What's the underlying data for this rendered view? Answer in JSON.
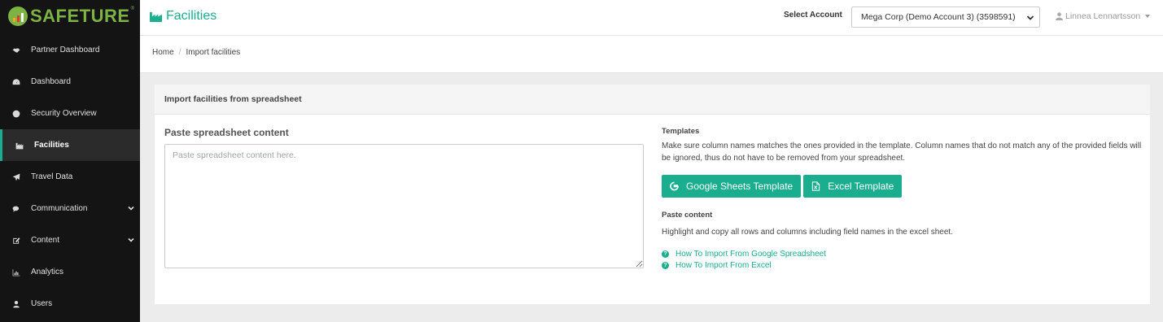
{
  "brand": {
    "name": "SAFETURE",
    "reg": "®",
    "accent": "#7cb342"
  },
  "sidebar": {
    "items": [
      {
        "label": "Partner Dashboard",
        "icon": "handshake-icon"
      },
      {
        "label": "Dashboard",
        "icon": "dashboard-icon"
      },
      {
        "label": "Security Overview",
        "icon": "globe-icon"
      },
      {
        "label": "Facilities",
        "icon": "factory-icon",
        "active": true
      },
      {
        "label": "Travel Data",
        "icon": "plane-icon"
      },
      {
        "label": "Communication",
        "icon": "comments-icon",
        "expandable": true
      },
      {
        "label": "Content",
        "icon": "edit-icon",
        "expandable": true
      },
      {
        "label": "Analytics",
        "icon": "bar-chart-icon"
      },
      {
        "label": "Users",
        "icon": "user-icon"
      }
    ]
  },
  "header": {
    "title": "Facilities",
    "account_label": "Select Account",
    "account_value": "Mega Corp (Demo Account 3) (3598591)",
    "user_name": "Linnea Lennartsson"
  },
  "breadcrumb": {
    "home": "Home",
    "current": "Import facilities"
  },
  "panel": {
    "heading": "Import facilities from spreadsheet",
    "paste_title": "Paste spreadsheet content",
    "paste_placeholder": "Paste spreadsheet content here.",
    "templates_heading": "Templates",
    "templates_desc": "Make sure column names matches the ones provided in the template. Column names that do not match any of the provided fields will be ignored, thus do not have to be removed from your spreadsheet.",
    "google_btn": "Google Sheets Template",
    "excel_btn": "Excel Template",
    "paste_heading": "Paste content",
    "paste_desc": "Highlight and copy all rows and columns including field names in the excel sheet.",
    "link_google": "How To Import From Google Spreadsheet",
    "link_excel": "How To Import From Excel"
  },
  "colors": {
    "primary": "#1aae8e",
    "sidebar_bg": "#141414"
  }
}
